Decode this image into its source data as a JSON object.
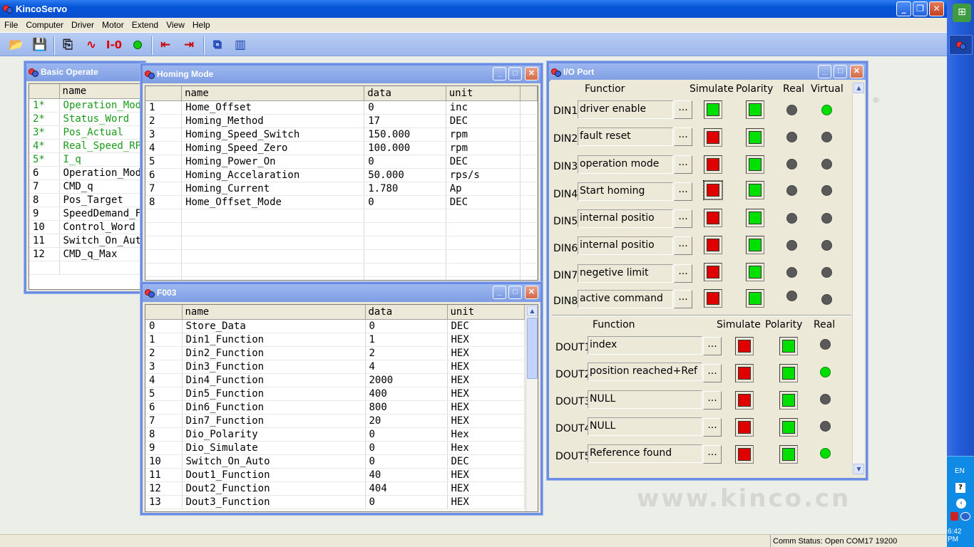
{
  "app": {
    "title": "KincoServo"
  },
  "menu": [
    "File",
    "Computer",
    "Driver",
    "Motor",
    "Extend",
    "View",
    "Help"
  ],
  "toolbar": {
    "icons": [
      "open-folder-icon",
      "save-icon",
      "connect-icon",
      "scope-icon",
      "io-icon",
      "status-light-icon",
      "upload-icon",
      "download-icon",
      "cascade-windows-icon",
      "tile-windows-icon"
    ],
    "io_label": "I-0"
  },
  "basic_operate": {
    "title": "Basic Operate",
    "header": {
      "num": "",
      "name": "name"
    },
    "rows": [
      {
        "num": "1*",
        "name": "Operation_Mod"
      },
      {
        "num": "2*",
        "name": "Status_Word"
      },
      {
        "num": "3*",
        "name": "Pos_Actual"
      },
      {
        "num": "4*",
        "name": "Real_Speed_RP"
      },
      {
        "num": "5*",
        "name": "I_q"
      },
      {
        "num": "6",
        "name": "Operation_Mod"
      },
      {
        "num": "7",
        "name": "CMD_q"
      },
      {
        "num": "8",
        "name": "Pos_Target"
      },
      {
        "num": "9",
        "name": "SpeedDemand_F"
      },
      {
        "num": "10",
        "name": "Control_Word"
      },
      {
        "num": "11",
        "name": "Switch_On_Aut"
      },
      {
        "num": "12",
        "name": "CMD_q_Max"
      }
    ]
  },
  "homing_mode": {
    "title": "Homing Mode",
    "header": {
      "name": "name",
      "data": "data",
      "unit": "unit"
    },
    "rows": [
      {
        "num": "1",
        "name": "Home_Offset",
        "data": "0",
        "unit": "inc"
      },
      {
        "num": "2",
        "name": "Homing_Method",
        "data": "17",
        "unit": "DEC"
      },
      {
        "num": "3",
        "name": "Homing_Speed_Switch",
        "data": "150.000",
        "unit": "rpm"
      },
      {
        "num": "4",
        "name": "Homing_Speed_Zero",
        "data": "100.000",
        "unit": "rpm"
      },
      {
        "num": "5",
        "name": "Homing_Power_On",
        "data": "0",
        "unit": "DEC"
      },
      {
        "num": "6",
        "name": "Homing_Accelaration",
        "data": "50.000",
        "unit": "rps/s"
      },
      {
        "num": "7",
        "name": "Homing_Current",
        "data": "1.780",
        "unit": "Ap"
      },
      {
        "num": "8",
        "name": "Home_Offset_Mode",
        "data": "0",
        "unit": "DEC"
      }
    ]
  },
  "f003": {
    "title": "F003",
    "header": {
      "name": "name",
      "data": "data",
      "unit": "unit"
    },
    "rows": [
      {
        "num": "0",
        "name": "Store_Data",
        "data": "0",
        "unit": "DEC"
      },
      {
        "num": "1",
        "name": "Din1_Function",
        "data": "1",
        "unit": "HEX"
      },
      {
        "num": "2",
        "name": "Din2_Function",
        "data": "2",
        "unit": "HEX"
      },
      {
        "num": "3",
        "name": "Din3_Function",
        "data": "4",
        "unit": "HEX"
      },
      {
        "num": "4",
        "name": "Din4_Function",
        "data": "2000",
        "unit": "HEX"
      },
      {
        "num": "5",
        "name": "Din5_Function",
        "data": "400",
        "unit": "HEX"
      },
      {
        "num": "6",
        "name": "Din6_Function",
        "data": "800",
        "unit": "HEX"
      },
      {
        "num": "7",
        "name": "Din7_Function",
        "data": "20",
        "unit": "HEX"
      },
      {
        "num": "8",
        "name": "Dio_Polarity",
        "data": "0",
        "unit": "Hex"
      },
      {
        "num": "9",
        "name": "Dio_Simulate",
        "data": "0",
        "unit": "Hex"
      },
      {
        "num": "10",
        "name": "Switch_On_Auto",
        "data": "0",
        "unit": "DEC"
      },
      {
        "num": "11",
        "name": "Dout1_Function",
        "data": "40",
        "unit": "HEX"
      },
      {
        "num": "12",
        "name": "Dout2_Function",
        "data": "404",
        "unit": "HEX"
      },
      {
        "num": "13",
        "name": "Dout3_Function",
        "data": "0",
        "unit": "HEX"
      }
    ]
  },
  "io_port": {
    "title": "I/O Port",
    "din_headers": {
      "function": "Functior",
      "simulate": "Simulate",
      "polarity": "Polarity",
      "real": "Real",
      "virtual": "Virtual"
    },
    "dout_headers": {
      "function": "Function",
      "simulate": "Simulate",
      "polarity": "Polarity",
      "real": "Real"
    },
    "ellipsis": "...",
    "din": [
      {
        "label": "DIN1",
        "function": "driver enable",
        "simulate": "green",
        "polarity": "green",
        "real": "off",
        "virtual": "on"
      },
      {
        "label": "DIN2",
        "function": "fault reset",
        "simulate": "red",
        "polarity": "green",
        "real": "off",
        "virtual": "off"
      },
      {
        "label": "DIN3",
        "function": "operation mode",
        "simulate": "red",
        "polarity": "green",
        "real": "off",
        "virtual": "off"
      },
      {
        "label": "DIN4",
        "function": "Start homing",
        "simulate": "red",
        "polarity": "green",
        "real": "off",
        "virtual": "off"
      },
      {
        "label": "DIN5",
        "function": "internal positio",
        "simulate": "red",
        "polarity": "green",
        "real": "off",
        "virtual": "off"
      },
      {
        "label": "DIN6",
        "function": "internal positio",
        "simulate": "red",
        "polarity": "green",
        "real": "off",
        "virtual": "off"
      },
      {
        "label": "DIN7",
        "function": "negetive limit",
        "simulate": "red",
        "polarity": "green",
        "real": "off",
        "virtual": "off"
      },
      {
        "label": "DIN8",
        "function": "active command",
        "simulate": "red",
        "polarity": "green",
        "real": "off",
        "virtual": "off"
      }
    ],
    "dout": [
      {
        "label": "DOUT1",
        "function": "index",
        "simulate": "red",
        "polarity": "green",
        "real": "off"
      },
      {
        "label": "DOUT2",
        "function": "position reached+Ref",
        "simulate": "red",
        "polarity": "green",
        "real": "on"
      },
      {
        "label": "DOUT3",
        "function": "NULL",
        "simulate": "red",
        "polarity": "green",
        "real": "off"
      },
      {
        "label": "DOUT4",
        "function": "NULL",
        "simulate": "red",
        "polarity": "green",
        "real": "off"
      },
      {
        "label": "DOUT5",
        "function": "Reference found",
        "simulate": "red",
        "polarity": "green",
        "real": "on"
      }
    ]
  },
  "watermark": "www.kinco.cn",
  "registered_mark": "®",
  "status": {
    "text": "Comm Status: Open  COM17  19200"
  },
  "taskbar": {
    "lang": "EN",
    "clock": "6:42 PM",
    "help": "?"
  }
}
